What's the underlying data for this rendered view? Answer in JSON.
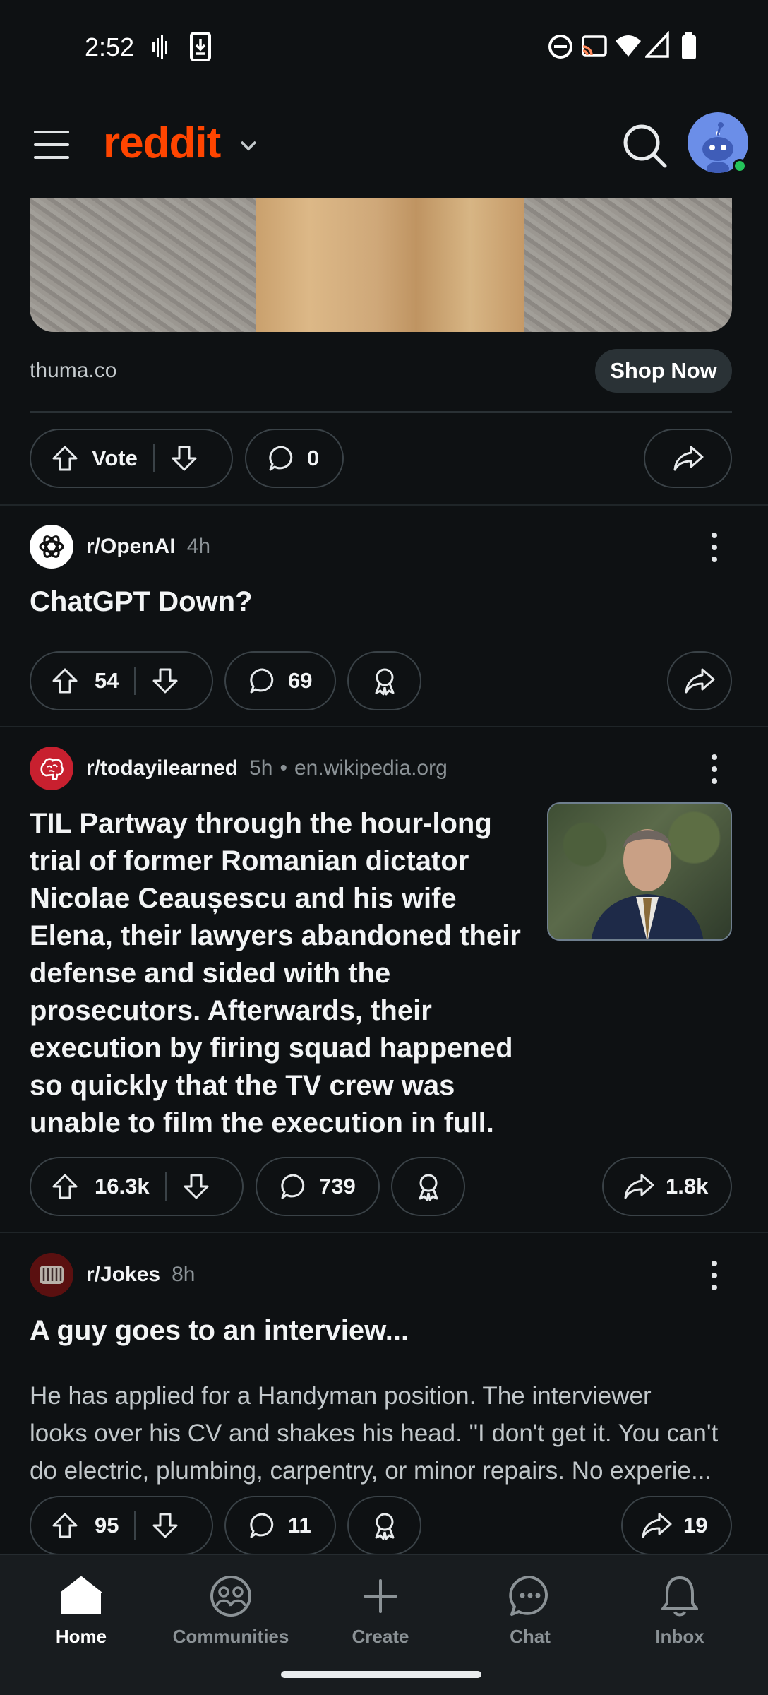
{
  "status_bar": {
    "time": "2:52"
  },
  "header": {
    "logo": "reddit"
  },
  "ad": {
    "domain": "thuma.co",
    "cta": "Shop Now",
    "vote_label": "Vote",
    "comments": "0"
  },
  "posts": [
    {
      "subreddit": "r/OpenAI",
      "age": "4h",
      "title": "ChatGPT Down?",
      "upvotes": "54",
      "comments": "69"
    },
    {
      "subreddit": "r/todayilearned",
      "age": "5h",
      "domain": "en.wikipedia.org",
      "title_lines": [
        "TIL Partway through the hour-long",
        "trial of former Romanian dictator",
        "Nicolae Ceaușescu and his wife",
        "Elena, their lawyers abandoned their",
        "defense and sided with the",
        "prosecutors. Afterwards, their",
        "execution by firing squad happened",
        "so quickly that the TV crew was",
        "unable to film the execution in full."
      ],
      "upvotes": "16.3k",
      "comments": "739",
      "shares": "1.8k"
    },
    {
      "subreddit": "r/Jokes",
      "age": "8h",
      "title": "A guy goes to an interview...",
      "body_lines": [
        "He has applied for a Handyman position. The interviewer",
        "looks over his CV and shakes his head. \"I don't get it. You can't",
        "do electric, plumbing, carpentry, or minor repairs. No experie..."
      ],
      "upvotes": "95",
      "comments": "11",
      "shares": "19"
    }
  ],
  "bottom_nav": [
    {
      "label": "Home",
      "icon": "home-icon",
      "active": true
    },
    {
      "label": "Communities",
      "icon": "communities-icon"
    },
    {
      "label": "Create",
      "icon": "plus-icon"
    },
    {
      "label": "Chat",
      "icon": "chat-icon"
    },
    {
      "label": "Inbox",
      "icon": "bell-icon"
    }
  ],
  "colors": {
    "brand": "#ff4500",
    "background": "#0e1113",
    "online": "#24c45a"
  }
}
